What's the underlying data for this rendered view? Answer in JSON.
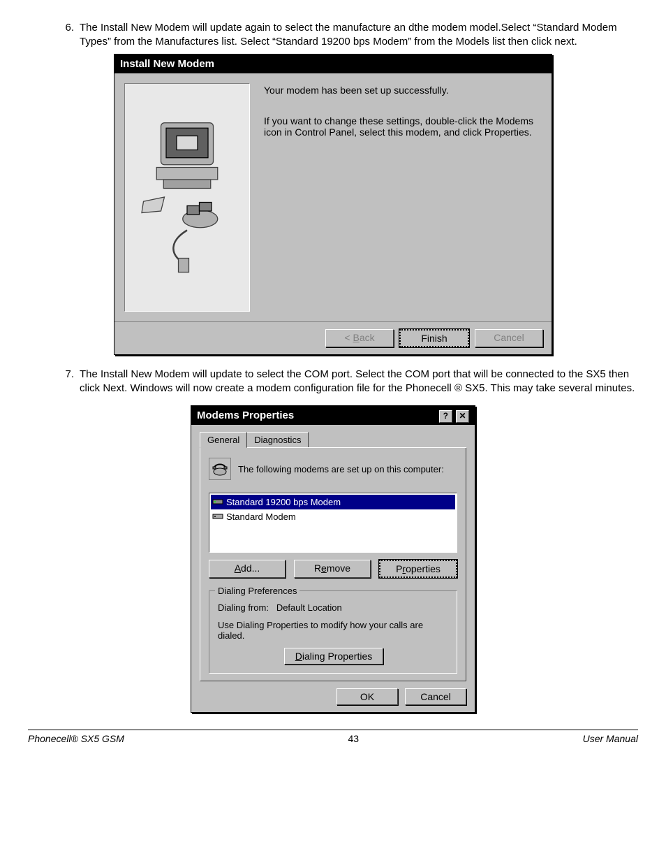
{
  "steps": {
    "s6": {
      "num": "6.",
      "text": "The Install New Modem will update again to select the manufacture an dthe modem model.Select “Standard Modem Types” from the Manufactures list. Select “Standard 19200 bps Modem” from the Models list then click next."
    },
    "s7": {
      "num": "7.",
      "text": "The Install New Modem will update to select the COM port. Select the COM port that will be connected to the SX5 then click Next. Windows will now create a modem configuration file for the Phonecell ® SX5. This may take several minutes."
    }
  },
  "win1": {
    "title": "Install New Modem",
    "line1": "Your modem has been set up successfully.",
    "line2": "If you want to change these settings, double-click the Modems icon in Control Panel, select this modem, and click Properties.",
    "back": "< Back",
    "finish": "Finish",
    "cancel": "Cancel"
  },
  "win2": {
    "title": "Modems Properties",
    "tab1": "General",
    "tab2": "Diagnostics",
    "info": "The following modems are set up on this computer:",
    "items": [
      "Standard 19200 bps Modem",
      "Standard Modem"
    ],
    "add": "Add...",
    "remove": "Remove",
    "properties": "Properties",
    "group_legend": "Dialing Preferences",
    "dialing_from_label": "Dialing from:",
    "dialing_from_value": "Default Location",
    "dialing_help": "Use Dialing Properties to modify how your calls are dialed.",
    "dialing_btn": "Dialing Properties",
    "ok": "OK",
    "cancel": "Cancel"
  },
  "footer": {
    "left": "Phonecell® SX5 GSM",
    "page": "43",
    "right": "User Manual"
  }
}
